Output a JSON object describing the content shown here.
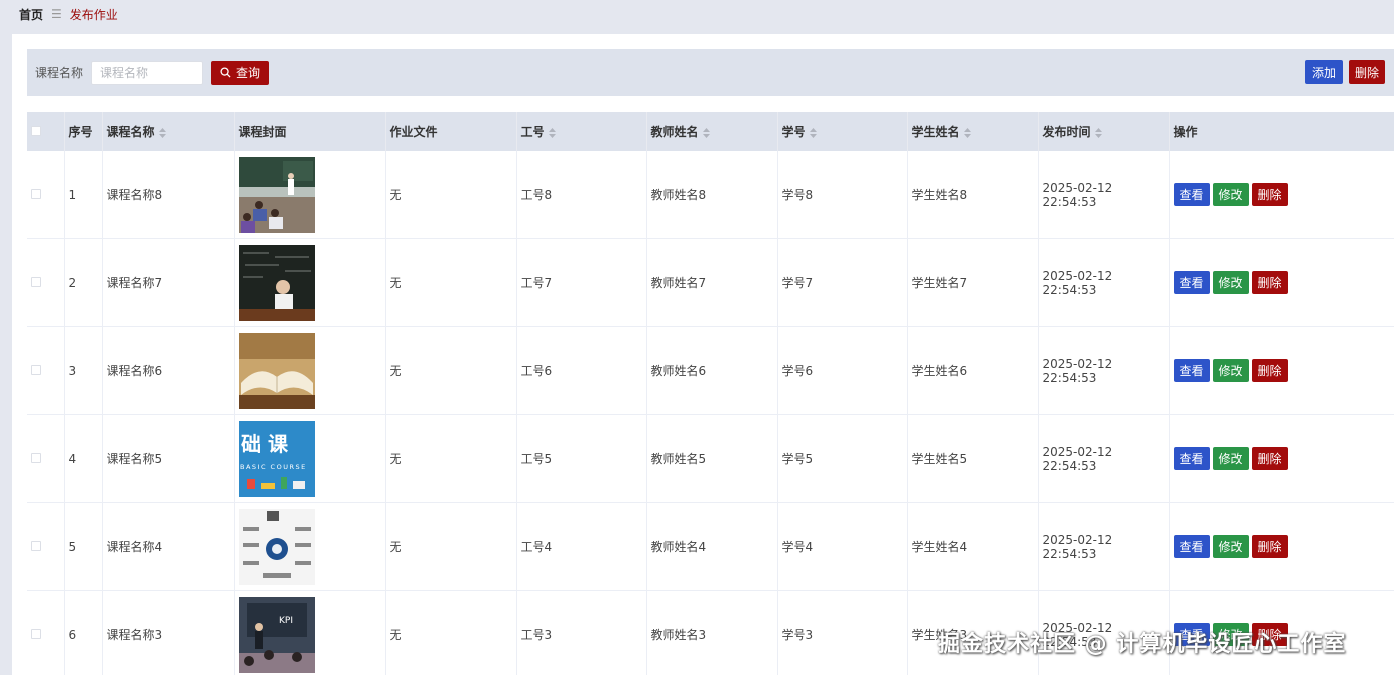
{
  "breadcrumb": {
    "home": "首页",
    "separator": "☰",
    "current": "发布作业"
  },
  "search": {
    "label": "课程名称",
    "placeholder": "课程名称",
    "value": "",
    "query_label": "查询"
  },
  "toolbar": {
    "add_label": "添加",
    "delete_label": "删除"
  },
  "table": {
    "headers": {
      "index": "序号",
      "course_name": "课程名称",
      "cover": "课程封面",
      "file": "作业文件",
      "job_no": "工号",
      "teacher": "教师姓名",
      "student_no": "学号",
      "student": "学生姓名",
      "publish_time": "发布时间",
      "actions": "操作"
    },
    "action_labels": {
      "view": "查看",
      "edit": "修改",
      "delete": "删除"
    },
    "rows": [
      {
        "index": "1",
        "course_name": "课程名称8",
        "file": "无",
        "job_no": "工号8",
        "teacher": "教师姓名8",
        "student_no": "学号8",
        "student": "学生姓名8",
        "publish_time": "2025-02-12 22:54:53",
        "cover_icon": "classroom-photo"
      },
      {
        "index": "2",
        "course_name": "课程名称7",
        "file": "无",
        "job_no": "工号7",
        "teacher": "教师姓名7",
        "student_no": "学号7",
        "student": "学生姓名7",
        "publish_time": "2025-02-12 22:54:53",
        "cover_icon": "blackboard-student-photo"
      },
      {
        "index": "3",
        "course_name": "课程名称6",
        "file": "无",
        "job_no": "工号6",
        "teacher": "教师姓名6",
        "student_no": "学号6",
        "student": "学生姓名6",
        "publish_time": "2025-02-12 22:54:53",
        "cover_icon": "open-book-photo"
      },
      {
        "index": "4",
        "course_name": "课程名称5",
        "file": "无",
        "job_no": "工号5",
        "teacher": "教师姓名5",
        "student_no": "学号5",
        "student": "学生姓名5",
        "publish_time": "2025-02-12 22:54:53",
        "cover_icon": "basic-course-banner",
        "cover_text": "础 课",
        "cover_subtext": "BASIC COURSE"
      },
      {
        "index": "5",
        "course_name": "课程名称4",
        "file": "无",
        "job_no": "工号4",
        "teacher": "教师姓名4",
        "student_no": "学号4",
        "student": "学生姓名4",
        "publish_time": "2025-02-12 22:54:53",
        "cover_icon": "infographic-photo"
      },
      {
        "index": "6",
        "course_name": "课程名称3",
        "file": "无",
        "job_no": "工号3",
        "teacher": "教师姓名3",
        "student_no": "学号3",
        "student": "学生姓名3",
        "publish_time": "2025-02-12 22:54:53",
        "cover_icon": "kpi-meeting-photo",
        "cover_text": "KPI"
      }
    ]
  },
  "watermark": "掘金技术社区 @ 计算机毕设匠心工作室",
  "colors": {
    "primary_red": "#a30c0c",
    "primary_blue": "#2d54c9",
    "edit_green": "#2a9547",
    "header_bg": "#dde2ec"
  }
}
